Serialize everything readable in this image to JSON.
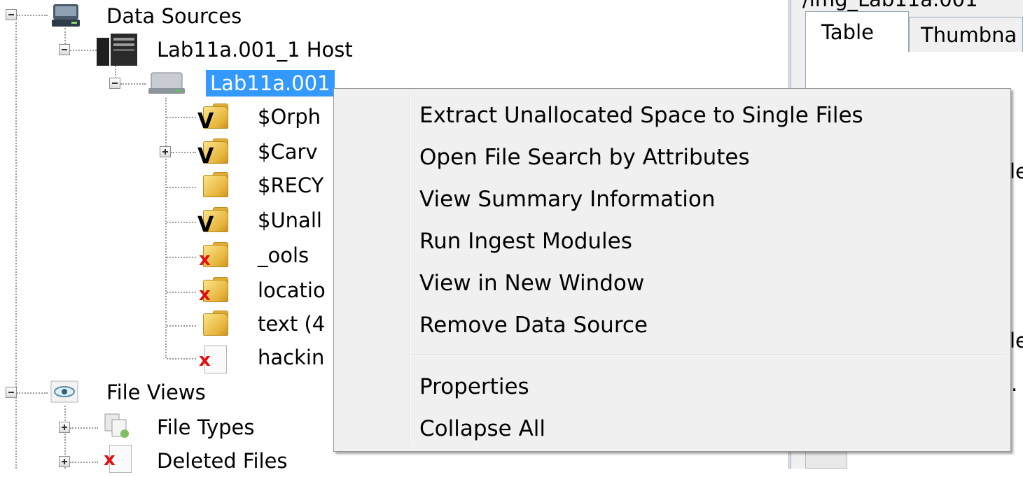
{
  "tree": {
    "data_sources": "Data Sources",
    "host": "Lab11a.001_1 Host",
    "image": "Lab11a.001",
    "children": [
      "$Orph",
      "$Carv",
      "$RECY",
      "$Unall",
      "_ools",
      "locatio",
      "text (4",
      "hackin"
    ],
    "file_views": "File Views",
    "file_types": "File Types",
    "deleted_files": "Deleted Files"
  },
  "right_panel": {
    "path_partial": "/img_Lab11a.001",
    "tabs": [
      "Table",
      "Thumbna"
    ],
    "clipped_text": [
      "le",
      "le",
      "."
    ]
  },
  "context_menu": {
    "items": [
      "Extract Unallocated Space to Single Files",
      "Open File Search by Attributes",
      "View Summary Information",
      "Run Ingest Modules",
      "View in New Window",
      "Remove Data Source"
    ],
    "items_after_separator": [
      "Properties",
      "Collapse All"
    ]
  },
  "icons": {
    "data_sources": "drive-icon",
    "host": "server-icon",
    "image": "disk-icon",
    "file_views": "eye-icon",
    "file_types": "file-types-icon",
    "deleted_files": "deleted-file-icon"
  },
  "colors": {
    "selection": "#3399ff",
    "menu_bg": "#f0f0f0",
    "deleted_mark": "#e01010"
  }
}
